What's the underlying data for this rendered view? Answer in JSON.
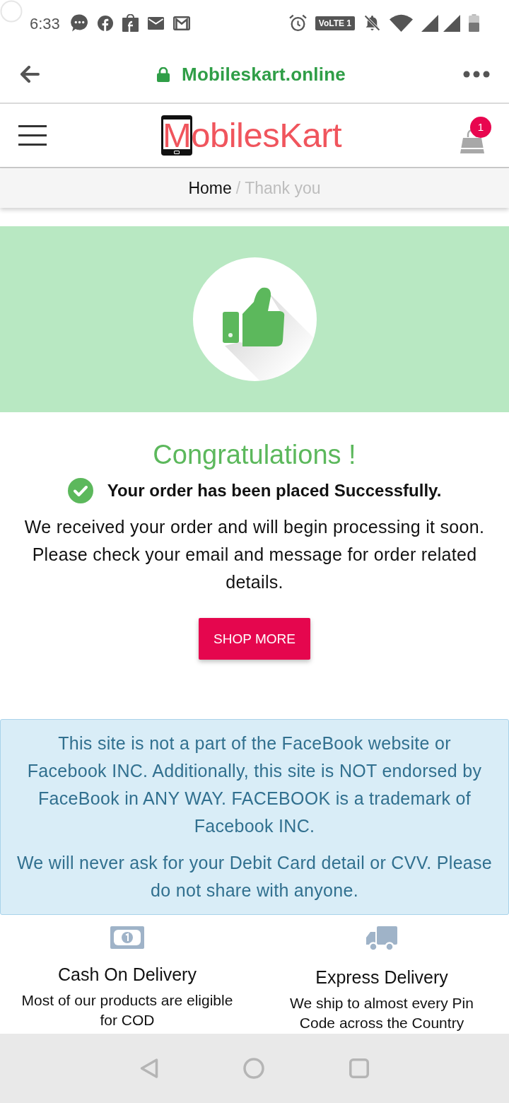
{
  "status_bar": {
    "time": "6:33",
    "network_badge": "VoLTE 1"
  },
  "browser_bar": {
    "url": "Mobileskart.online"
  },
  "header": {
    "logo": "MobilesKart",
    "cart_count": "1"
  },
  "breadcrumb": {
    "separator": "/",
    "items": [
      {
        "label": "Home",
        "current": false
      },
      {
        "label": "Thank you",
        "current": true
      }
    ]
  },
  "confirmation": {
    "title": "Congratulations !",
    "status": "Your order has been placed Successfully.",
    "message": "We received your order and will begin processing it soon. Please check your email and message for order related details.",
    "button": "SHOP MORE"
  },
  "notice": {
    "paragraphs": [
      "This site is not a part of the FaceBook website or Facebook INC. Additionally, this site is NOT endorsed by FaceBook in ANY WAY. FACEBOOK is a trademark of Facebook INC.",
      "We will never ask for your Debit Card detail or CVV. Please do not share with anyone."
    ]
  },
  "features": [
    {
      "kind": "cash",
      "title": "Cash On Delivery",
      "text": "Most of our products are eligible for COD"
    },
    {
      "kind": "truck",
      "title": "Express Delivery",
      "text": "We ship to almost every Pin Code across the Country"
    }
  ]
}
